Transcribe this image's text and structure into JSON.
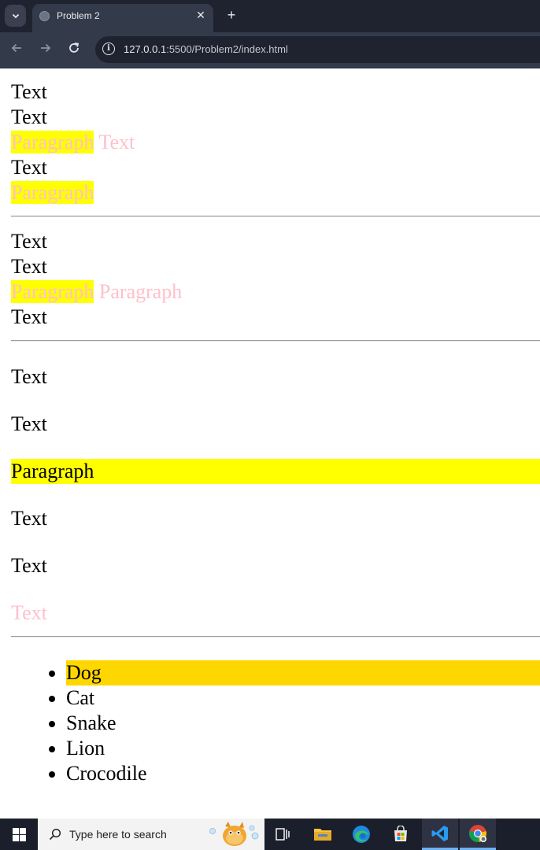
{
  "browser": {
    "tab_title": "Problem 2",
    "url_host": "127.0.0.1",
    "url_path": ":5500/Problem2/index.html"
  },
  "page": {
    "section1": {
      "lines": [
        "Text",
        "Text",
        "Paragraph",
        "Text",
        "Text",
        "Paragraph"
      ]
    },
    "section2": {
      "lines": [
        "Text",
        "Text",
        "Paragraph",
        "Paragraph",
        "Text"
      ]
    },
    "section3": {
      "paragraphs": [
        "Text",
        "Text",
        "Paragraph",
        "Text",
        "Text",
        "Text"
      ]
    },
    "list": {
      "items": [
        "Dog",
        "Cat",
        "Snake",
        "Lion",
        "Crocodile"
      ]
    },
    "colors": {
      "highlight": "#ffff00",
      "pink_text": "#ffc0cb",
      "gold": "#ffd700"
    }
  },
  "taskbar": {
    "search_placeholder": "Type here to search",
    "icons": [
      "windows-start-icon",
      "search-icon",
      "task-view-icon",
      "file-explorer-icon",
      "edge-icon",
      "store-icon",
      "vscode-icon",
      "chrome-icon"
    ]
  }
}
